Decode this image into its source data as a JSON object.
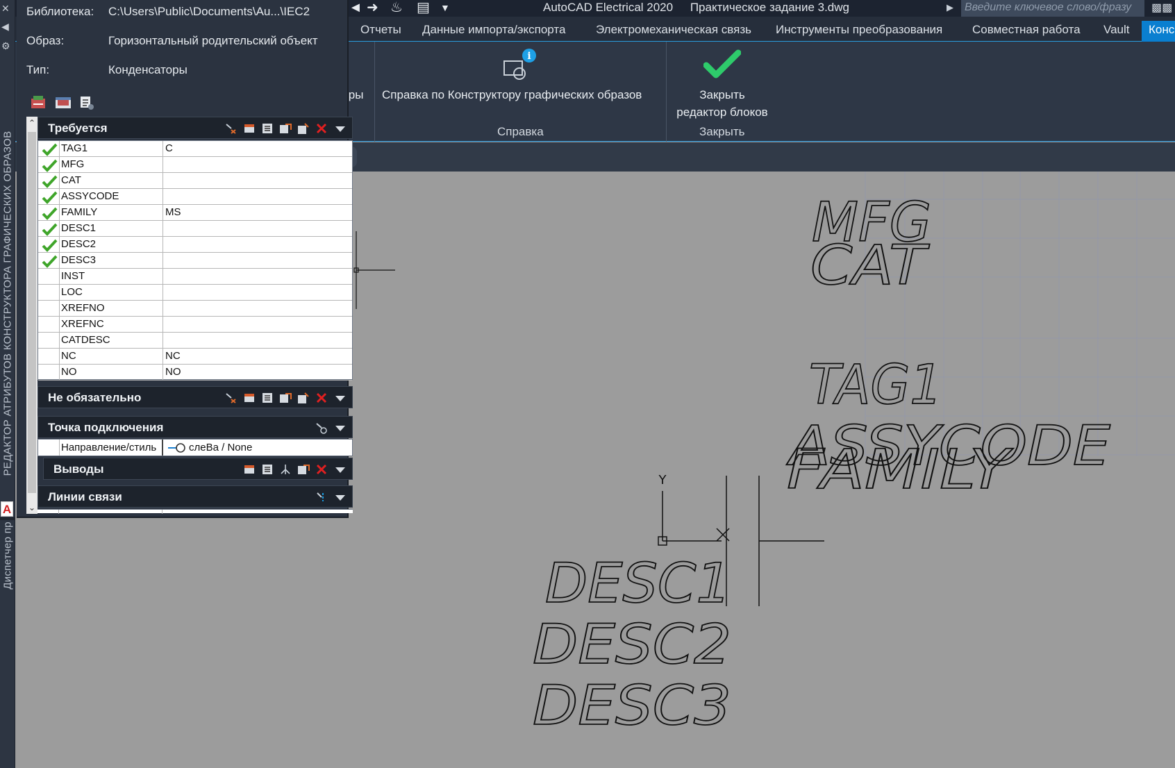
{
  "titlebar": {
    "app_name": "AutoCAD Electrical 2020",
    "file_name": "Практическое задание 3.dwg",
    "search_placeholder": "Введите ключевое слово/фразу"
  },
  "ribbon_tabs": [
    {
      "label": "Отчеты"
    },
    {
      "label": "Данные импорта/экспорта"
    },
    {
      "label": "Электромеханическая связь"
    },
    {
      "label": "Инструменты преобразования"
    },
    {
      "label": "Совместная работа"
    },
    {
      "label": "Vault"
    },
    {
      "label": "Конс"
    }
  ],
  "ribbon": {
    "partial_label": "тры",
    "help_button_label": "Справка по Конструктору графических образов",
    "help_panel_title": "Справка",
    "close_button_line1": "Закрыть",
    "close_button_line2": "редактор блоков",
    "close_panel_title": "Закрыть"
  },
  "vertical_strip": {
    "palette_title": "РЕДАКТОР АТРИБУТОВ КОНСТРУКТОРА ГРАФИЧЕСКИХ ОБРАЗОВ",
    "project_manager": "Диспетчер пр",
    "acad_logo": "A"
  },
  "palette": {
    "library_label": "Библиотека:",
    "library_value": "C:\\Users\\Public\\Documents\\Au...\\IEC2",
    "image_label": "Образ:",
    "image_value": "Горизонтальный родительский объект",
    "type_label": "Тип:",
    "type_value": "Конденсаторы",
    "sections": {
      "required": "Требуется",
      "optional": "Не обязательно",
      "connection_point": "Точка подключения",
      "terminals": "Выводы",
      "link_lines": "Линии связи"
    },
    "required_rows": [
      {
        "name": "TAG1",
        "value": "C",
        "checked": true
      },
      {
        "name": "MFG",
        "value": "",
        "checked": true
      },
      {
        "name": "CAT",
        "value": "",
        "checked": true
      },
      {
        "name": "ASSYCODE",
        "value": "",
        "checked": true
      },
      {
        "name": "FAMILY",
        "value": "MS",
        "checked": true
      },
      {
        "name": "DESC1",
        "value": "",
        "checked": true
      },
      {
        "name": "DESC2",
        "value": "",
        "checked": true
      },
      {
        "name": "DESC3",
        "value": "",
        "checked": true
      },
      {
        "name": "INST",
        "value": "",
        "checked": false
      },
      {
        "name": "LOC",
        "value": "",
        "checked": false
      },
      {
        "name": "XREFNO",
        "value": "",
        "checked": false
      },
      {
        "name": "XREFNC",
        "value": "",
        "checked": false
      },
      {
        "name": "CATDESC",
        "value": "",
        "checked": false
      },
      {
        "name": "NC",
        "value": "NC",
        "checked": false
      },
      {
        "name": "NO",
        "value": "NO",
        "checked": false
      }
    ],
    "connection_row": {
      "name": "Направление/стиль",
      "value": "слеВа / None"
    }
  },
  "drawing": {
    "labels": [
      "MFG",
      "CAT",
      "TAG1",
      "ASSYCODE",
      "FAMILY",
      "DESC1",
      "DESC2",
      "DESC3"
    ],
    "ucs_axis_label": "Y"
  },
  "colors": {
    "check_green": "#3fa52a",
    "close_check_green": "#2ecb6b",
    "active_tab_blue": "#0a7fd0",
    "delete_red": "#e02020"
  }
}
